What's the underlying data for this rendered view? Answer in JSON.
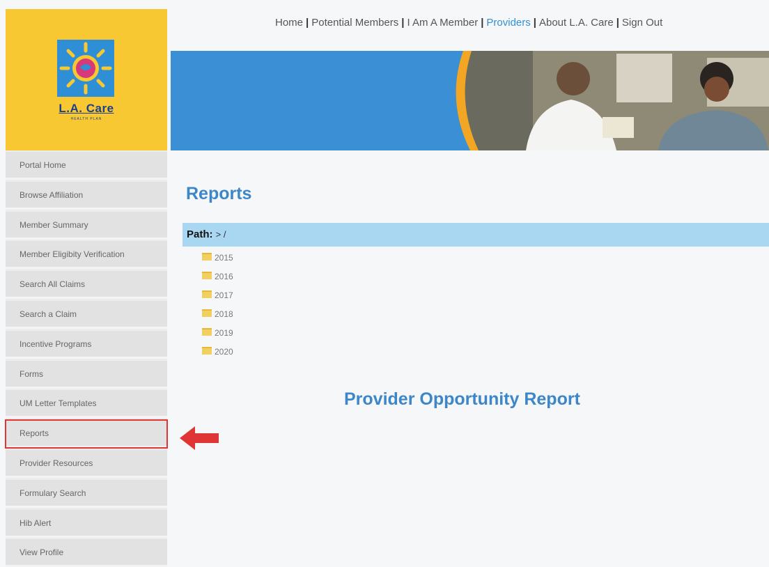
{
  "logo": {
    "name": "L.A. Care",
    "tagline": "HEALTH PLAN"
  },
  "top_nav": {
    "items": [
      {
        "label": "Home",
        "active": false
      },
      {
        "label": "Potential Members",
        "active": false
      },
      {
        "label": "I Am A Member",
        "active": false
      },
      {
        "label": "Providers",
        "active": true
      },
      {
        "label": "About L.A. Care",
        "active": false
      },
      {
        "label": "Sign Out",
        "active": false
      }
    ],
    "separator": "|"
  },
  "sidebar": {
    "items": [
      {
        "label": "Portal Home"
      },
      {
        "label": "Browse Affiliation"
      },
      {
        "label": "Member Summary"
      },
      {
        "label": "Member Eligibity Verification"
      },
      {
        "label": "Search All Claims"
      },
      {
        "label": "Search a Claim"
      },
      {
        "label": "Incentive Programs"
      },
      {
        "label": "Forms"
      },
      {
        "label": "UM Letter Templates"
      },
      {
        "label": "Reports"
      },
      {
        "label": "Provider Resources"
      },
      {
        "label": "Formulary Search"
      },
      {
        "label": "Hib Alert"
      },
      {
        "label": "View Profile"
      }
    ],
    "highlighted": "Reports"
  },
  "main": {
    "title": "Reports",
    "path_label": "Path:",
    "path_value": "> /",
    "folders": [
      "2015",
      "2016",
      "2017",
      "2018",
      "2019",
      "2020"
    ],
    "report_title": "Provider Opportunity Report"
  },
  "colors": {
    "logo_bg": "#f7c832",
    "banner_blue": "#3b8fd4",
    "title_blue": "#3d86c8",
    "path_bar": "#a9d7f2",
    "highlight_red": "#e03535"
  }
}
